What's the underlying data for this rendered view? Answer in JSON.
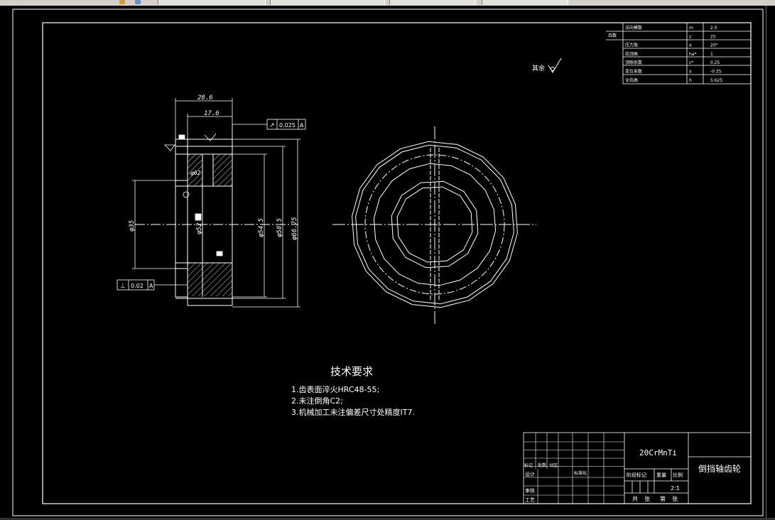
{
  "params": {
    "rows": [
      {
        "name": "法向模数",
        "sym": "m",
        "val": "2.5"
      },
      {
        "name": "",
        "sym": "z",
        "val": "25"
      },
      {
        "name": "压力角",
        "sym": "α",
        "val": "20°"
      },
      {
        "name": "齿顶高",
        "sym": "ha*",
        "val": "1"
      },
      {
        "name": "顶隙系数",
        "sym": "c*",
        "val": "0.25"
      },
      {
        "name": "变位系数",
        "sym": "x",
        "val": "-0.35"
      },
      {
        "name": "全齿高",
        "sym": "h",
        "val": "5.625"
      }
    ],
    "side_label": "齿数"
  },
  "roughness_note": "其余",
  "dims": {
    "d1": "28.6",
    "d2": "17.6",
    "d3": "φ62",
    "d4": "φ35",
    "d5": "φ52",
    "d6": "φ54.5",
    "d7": "φ58.5",
    "d8": "φ66.75"
  },
  "tolerances": {
    "runout": "0.025",
    "runout_datum": "A",
    "runout_sym": "↗",
    "perp": "0.02",
    "perp_datum": "A",
    "perp_sym": "⊥"
  },
  "tech": {
    "title": "技术要求",
    "items": [
      "1.齿表面淬火HRC48-55;",
      "2.未注倒角C2;",
      "3.机械加工未注偏差尺寸处精度IT7."
    ]
  },
  "title_block": {
    "material": "20CrMnTi",
    "part_name": "倒挡轴齿轮",
    "scale": "2:1",
    "row_labels": [
      "标记",
      "处数",
      "分区",
      "标准化",
      "设计",
      "审核",
      "工艺"
    ],
    "stage_label": "阶段标记",
    "weight_label": "重量",
    "scale_label": "比例",
    "sheet1": "共",
    "sheet2": "张",
    "sheet3": "第",
    "sheet4": "张"
  }
}
